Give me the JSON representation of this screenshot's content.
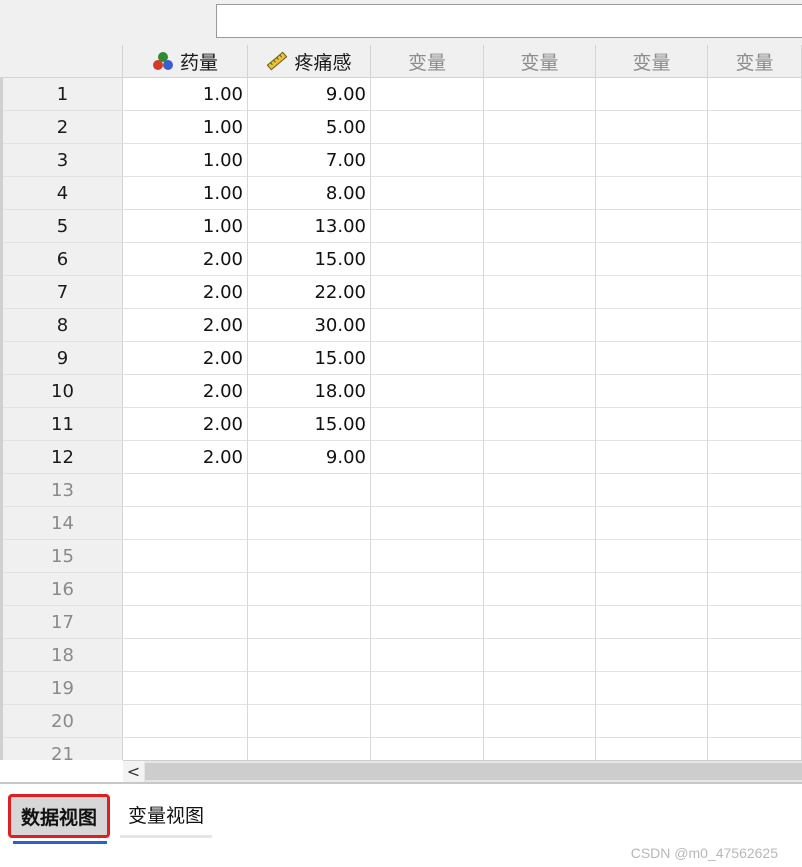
{
  "columns": [
    {
      "label": "药量",
      "icon": "nominal-variable-icon",
      "type": "var"
    },
    {
      "label": "疼痛感",
      "icon": "scale-ruler-icon",
      "type": "var"
    },
    {
      "label": "变量",
      "type": "empty"
    },
    {
      "label": "变量",
      "type": "empty"
    },
    {
      "label": "变量",
      "type": "empty"
    },
    {
      "label": "变量",
      "type": "empty"
    }
  ],
  "rows": [
    {
      "num": "1",
      "values": [
        "1.00",
        "9.00"
      ]
    },
    {
      "num": "2",
      "values": [
        "1.00",
        "5.00"
      ]
    },
    {
      "num": "3",
      "values": [
        "1.00",
        "7.00"
      ]
    },
    {
      "num": "4",
      "values": [
        "1.00",
        "8.00"
      ]
    },
    {
      "num": "5",
      "values": [
        "1.00",
        "13.00"
      ]
    },
    {
      "num": "6",
      "values": [
        "2.00",
        "15.00"
      ]
    },
    {
      "num": "7",
      "values": [
        "2.00",
        "22.00"
      ]
    },
    {
      "num": "8",
      "values": [
        "2.00",
        "30.00"
      ]
    },
    {
      "num": "9",
      "values": [
        "2.00",
        "15.00"
      ]
    },
    {
      "num": "10",
      "values": [
        "2.00",
        "18.00"
      ]
    },
    {
      "num": "11",
      "values": [
        "2.00",
        "15.00"
      ]
    },
    {
      "num": "12",
      "values": [
        "2.00",
        "9.00"
      ]
    },
    {
      "num": "13",
      "values": []
    },
    {
      "num": "14",
      "values": []
    },
    {
      "num": "15",
      "values": []
    },
    {
      "num": "16",
      "values": []
    },
    {
      "num": "17",
      "values": []
    },
    {
      "num": "18",
      "values": []
    },
    {
      "num": "19",
      "values": []
    },
    {
      "num": "20",
      "values": []
    },
    {
      "num": "21",
      "values": []
    }
  ],
  "tabs": {
    "data_view": "数据视图",
    "variable_view": "变量视图"
  },
  "scroll_left_glyph": "<",
  "watermark": "CSDN @m0_47562625",
  "colors": {
    "header_bg": "#f0f0f0",
    "active_tab_border": "#e02020",
    "active_tab_underline": "#2a62c8"
  }
}
